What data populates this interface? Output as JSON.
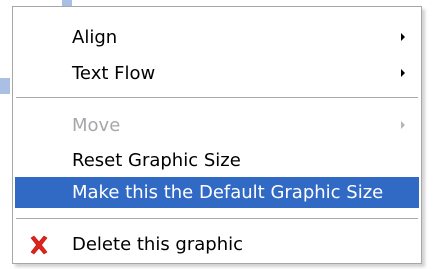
{
  "menu": {
    "items": [
      {
        "label": "Align",
        "has_submenu": true,
        "enabled": true
      },
      {
        "label": "Text Flow",
        "has_submenu": true,
        "enabled": true
      },
      {
        "label": "Move",
        "has_submenu": true,
        "enabled": false
      },
      {
        "label": "Reset Graphic Size",
        "has_submenu": false,
        "enabled": true
      },
      {
        "label": "Make this the Default Graphic Size",
        "has_submenu": false,
        "enabled": true,
        "highlighted": true
      },
      {
        "label": "Delete this graphic",
        "has_submenu": false,
        "enabled": true,
        "icon": "red-x-delete-icon"
      }
    ]
  },
  "colors": {
    "highlight": "#316ac5",
    "disabled_text": "#a7a6aa",
    "delete_icon": "#e0231b"
  }
}
